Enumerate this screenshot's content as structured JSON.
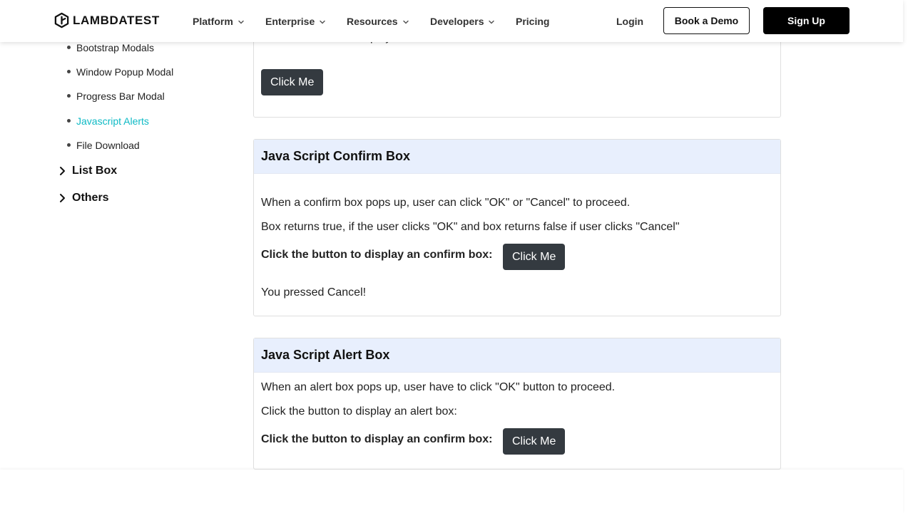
{
  "header": {
    "logo_text": "LAMBDATEST",
    "nav": [
      {
        "label": "Platform",
        "has_dropdown": true
      },
      {
        "label": "Enterprise",
        "has_dropdown": true
      },
      {
        "label": "Resources",
        "has_dropdown": true
      },
      {
        "label": "Developers",
        "has_dropdown": true
      },
      {
        "label": "Pricing",
        "has_dropdown": false
      }
    ],
    "login_label": "Login",
    "demo_label": "Book a Demo",
    "signup_label": "Sign Up"
  },
  "sidebar": {
    "sub_items": [
      {
        "label": "Bootstrap Modals",
        "active": false
      },
      {
        "label": "Window Popup Modal",
        "active": false
      },
      {
        "label": "Progress Bar Modal",
        "active": false
      },
      {
        "label": "Javascript Alerts",
        "active": true
      },
      {
        "label": "File Download",
        "active": false
      }
    ],
    "groups": [
      {
        "label": "List Box",
        "icon": "chevron-right-icon"
      },
      {
        "label": "Others",
        "icon": "chevron-right-icon"
      }
    ]
  },
  "alert_card_top": {
    "text": "Click the button to display an alert box:",
    "button_label": "Click Me"
  },
  "confirm_card": {
    "title": "Java Script Confirm Box",
    "line1": "When a confirm box pops up, user can click \"OK\" or \"Cancel\" to proceed.",
    "line2": "Box returns true, if the user clicks \"OK\" and box returns false if user clicks \"Cancel\"",
    "prompt": "Click the button to display an confirm box:",
    "button_label": "Click Me",
    "result": "You pressed Cancel!"
  },
  "alert_card": {
    "title": "Java Script Alert Box",
    "line1": "When an alert box pops up, user have to click \"OK\" button to proceed.",
    "line2": "Click the button to display an alert box:",
    "prompt": "Click the button to display an confirm box:",
    "button_label": "Click Me"
  },
  "colors": {
    "accent": "#0ebac5",
    "card_header_bg": "#e8effd",
    "button_bg": "#343a40"
  }
}
